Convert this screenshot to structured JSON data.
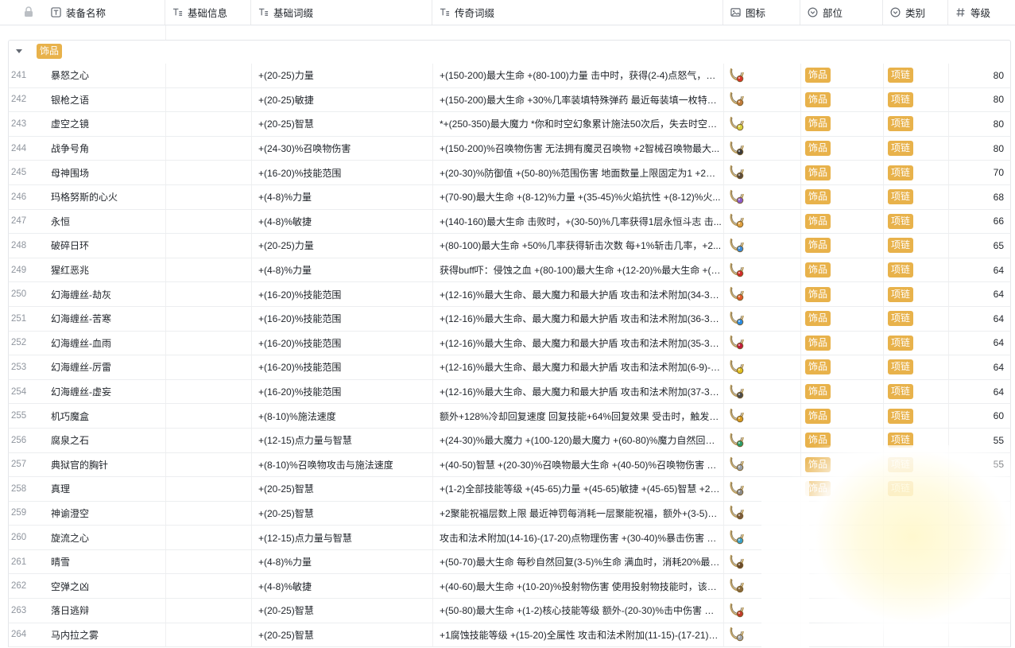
{
  "columns": {
    "name": "装备名称",
    "info": "基础信息",
    "base": "基础词缀",
    "legendary": "传奇词缀",
    "icon": "图标",
    "part": "部位",
    "type": "类别",
    "level": "等级"
  },
  "group": {
    "label": "饰品"
  },
  "rows": [
    {
      "num": "241",
      "name": "暴怒之心",
      "base": "+(20-25)力量",
      "legendary": "+(150-200)最大生命 +(80-100)力量 击中时，获得(2-4)点怒气，该...",
      "part": "饰品",
      "type": "项链",
      "level": "80",
      "gem": "#d8352a"
    },
    {
      "num": "242",
      "name": "银枪之语",
      "base": "+(20-25)敏捷",
      "legendary": "+(150-200)最大生命 +30%几率装填特殊弹药 最近每装填一枚特殊...",
      "part": "饰品",
      "type": "项链",
      "level": "80",
      "gem": "#c07a3a"
    },
    {
      "num": "243",
      "name": "虚空之镜",
      "base": "+(20-25)智慧",
      "legendary": "*+(250-350)最大魔力 *你和时空幻象累计施法50次后，失去时空幻...",
      "part": "饰品",
      "type": "项链",
      "level": "80",
      "gem": "#d8d040"
    },
    {
      "num": "244",
      "name": "战争号角",
      "base": "+(24-30)%召唤物伤害",
      "legendary": "+(150-200)%召唤物伤害 无法拥有魔灵召唤物 +2智械召唤物最大...",
      "part": "饰品",
      "type": "项链",
      "level": "80",
      "gem": "#3a3a3a"
    },
    {
      "num": "245",
      "name": "母神围场",
      "base": "+(16-20)%技能范围",
      "legendary": "+(20-30)%防御值 +(50-80)%范围伤害 地面数量上限固定为1 +2地...",
      "part": "饰品",
      "type": "项链",
      "level": "70",
      "gem": "#5a4a3a"
    },
    {
      "num": "246",
      "name": "玛格努斯的心火",
      "base": "+(4-8)%力量",
      "legendary": "+(70-90)最大生命 +(8-12)%力量 +(35-45)%火焰抗性 +(8-12)%火...",
      "part": "饰品",
      "type": "项链",
      "level": "68",
      "gem": "#8a5ac8"
    },
    {
      "num": "247",
      "name": "永恒",
      "base": "+(4-8)%敏捷",
      "legendary": "+(140-160)最大生命 击败时，+(30-50)%几率获得1层永恒斗志 击...",
      "part": "饰品",
      "type": "项链",
      "level": "66",
      "gem": "#e0a040"
    },
    {
      "num": "248",
      "name": "破碎日环",
      "base": "+(20-25)力量",
      "legendary": "+(80-100)最大生命 +50%几率获得斩击次数 每+1%斩击几率，+2...",
      "part": "饰品",
      "type": "项链",
      "level": "65",
      "gem": "#3a8ad8"
    },
    {
      "num": "249",
      "name": "猩红恶兆",
      "base": "+(4-8)%力量",
      "legendary": "获得buff吓：侵蚀之血 +(80-100)最大生命 +(12-20)%最大生命 +(12...",
      "part": "饰品",
      "type": "项链",
      "level": "64",
      "gem": "#d02a2a"
    },
    {
      "num": "250",
      "name": "幻海缠丝-劫灰",
      "base": "+(16-20)%技能范围",
      "legendary": "+(12-16)%最大生命、最大魔力和最大护盾 攻击和法术附加(34-37)...",
      "part": "饰品",
      "type": "项链",
      "level": "64",
      "gem": "#e05a2a"
    },
    {
      "num": "251",
      "name": "幻海缠丝-苦寒",
      "base": "+(16-20)%技能范围",
      "legendary": "+(12-16)%最大生命、最大魔力和最大护盾 攻击和法术附加(36-38)...",
      "part": "饰品",
      "type": "项链",
      "level": "64",
      "gem": "#2a8ae0"
    },
    {
      "num": "252",
      "name": "幻海缠丝-血雨",
      "base": "+(16-20)%技能范围",
      "legendary": "+(12-16)%最大生命、最大魔力和最大护盾 攻击和法术附加(35-38)...",
      "part": "饰品",
      "type": "项链",
      "level": "64",
      "gem": "#c01a3a"
    },
    {
      "num": "253",
      "name": "幻海缠丝-厉雷",
      "base": "+(16-20)%技能范围",
      "legendary": "+(12-16)%最大生命、最大魔力和最大护盾 攻击和法术附加(6-9)-(7...",
      "part": "饰品",
      "type": "项链",
      "level": "64",
      "gem": "#e0c020"
    },
    {
      "num": "254",
      "name": "幻海缠丝-虚妄",
      "base": "+(16-20)%技能范围",
      "legendary": "+(12-16)%最大生命、最大魔力和最大护盾 攻击和法术附加(37-39)...",
      "part": "饰品",
      "type": "项链",
      "level": "64",
      "gem": "#4a4a4a"
    },
    {
      "num": "255",
      "name": "机巧魔盒",
      "base": "+(8-10)%施法速度",
      "legendary": "额外+128%冷却回复速度 回复技能+64%回复效果 受击时，触发第...",
      "part": "饰品",
      "type": "项链",
      "level": "60",
      "gem": "#d89a20"
    },
    {
      "num": "256",
      "name": "腐泉之石",
      "base": "+(12-15)点力量与智慧",
      "legendary": "+(24-30)%最大魔力 +(100-120)最大魔力 +(60-80)%魔力自然回复...",
      "part": "饰品",
      "type": "项链",
      "level": "55",
      "gem": "#2a9a6a"
    },
    {
      "num": "257",
      "name": "典狱官的胸针",
      "base": "+(8-10)%召唤物攻击与施法速度",
      "legendary": "+(40-50)智慧 +(20-30)%召唤物最大生命 +(40-50)%召唤物伤害 你...",
      "part": "饰品",
      "type": "项链",
      "level": "55",
      "gem": "#9aa0a8"
    },
    {
      "num": "258",
      "name": "真理",
      "base": "+(20-25)智慧",
      "legendary": "+(1-2)全部技能等级 +(45-65)力量 +(45-65)敏捷 +(45-65)智慧 +25...",
      "part": "饰品",
      "type": "项链",
      "level": "",
      "gem": "#8a8a8a"
    },
    {
      "num": "259",
      "name": "神谕澄空",
      "base": "+(20-25)智慧",
      "legendary": "+2聚能祝福层数上限 最近神罚每消耗一层聚能祝福，额外+(3-5)%...",
      "part": "",
      "type": "",
      "level": "",
      "gem": "#7a5a3a"
    },
    {
      "num": "260",
      "name": "旋流之心",
      "base": "+(12-15)点力量与智慧",
      "legendary": "攻击和法术附加(14-16)-(17-20)点物理伤害 +(30-40)%暴击伤害 +(...",
      "part": "",
      "type": "",
      "level": "",
      "gem": "#3aa0c8"
    },
    {
      "num": "261",
      "name": "晴雪",
      "base": "+(4-8)%力量",
      "legendary": "+(50-70)最大生命 每秒自然回复(3-5)%生命 满血时，消耗20%最大...",
      "part": "",
      "type": "",
      "level": "",
      "gem": "#6a4a2a"
    },
    {
      "num": "262",
      "name": "空弹之凶",
      "base": "+(4-8)%敏捷",
      "legendary": "+(40-60)最大生命 +(10-20)%投射物伤害 使用投射物技能时，该次...",
      "part": "",
      "type": "",
      "level": "",
      "gem": "#8a6a3a"
    },
    {
      "num": "263",
      "name": "落日逃辩",
      "base": "+(20-25)智慧",
      "legendary": "+(50-80)最大生命 +(1-2)核心技能等级 额外-(20-30)%击中伤害 最...",
      "part": "",
      "type": "",
      "level": "",
      "gem": "#c03a2a"
    },
    {
      "num": "264",
      "name": "马内拉之雾",
      "base": "+(20-25)智慧",
      "legendary": "+1腐蚀技能等级 +(15-20)全属性 攻击和法术附加(11-15)-(17-21)点...",
      "part": "",
      "type": "",
      "level": "",
      "gem": "#a0a4aa"
    }
  ]
}
